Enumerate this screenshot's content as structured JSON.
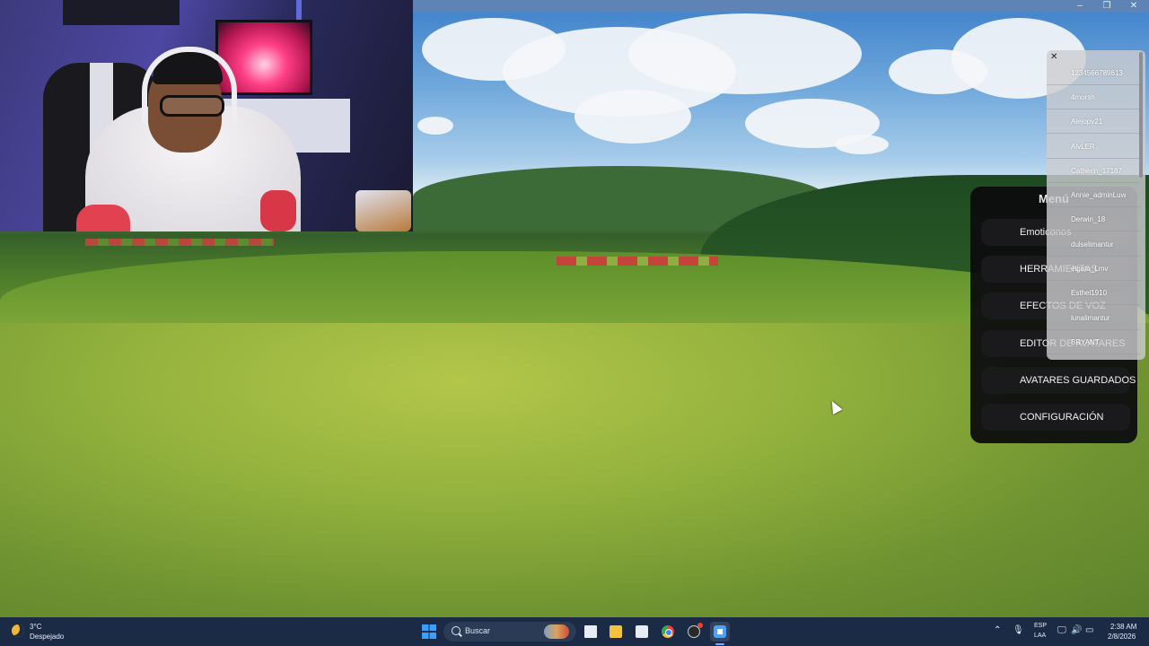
{
  "window": {
    "minimize_glyph": "–",
    "maximize_glyph": "❐",
    "close_glyph": "✕"
  },
  "menu": {
    "title": "Menú",
    "items": [
      {
        "label": "Emoticonos"
      },
      {
        "label": "HERRAMIENTAS"
      },
      {
        "label": "EFECTOS DE VOZ"
      },
      {
        "label": "EDITOR DE AVATARES"
      },
      {
        "label": "AVATARES GUARDADOS"
      },
      {
        "label": "CONFIGURACIÓN"
      }
    ]
  },
  "user_list": {
    "close_glyph": "✕",
    "users": [
      "1234566789613",
      "4morsh",
      "Alejopv21",
      "AlvLER",
      "Catherin_17187",
      "Annie_adminLuw",
      "Derwin_18",
      "dulselimantur",
      "elgato_Lmv",
      "Esthel1910",
      "lunalimantur",
      "BRYANT"
    ]
  },
  "taskbar": {
    "weather": {
      "temp": "3°C",
      "desc": "Despejado",
      "icon": "moon-icon"
    },
    "search": {
      "label": "Buscar"
    },
    "tray": {
      "chevron": "⌃",
      "mic": "🎙",
      "lang_top": "ESP",
      "lang_bottom": "LAA",
      "network": "🖵",
      "volume": "🔊",
      "battery": "▭"
    },
    "clock": {
      "time": "2:38 AM",
      "date": "2/8/2026"
    }
  },
  "colors": {
    "taskbar_bg": "#1c2b45",
    "menu_bg": "#0c0c0e",
    "accent": "#3aa0ff"
  }
}
